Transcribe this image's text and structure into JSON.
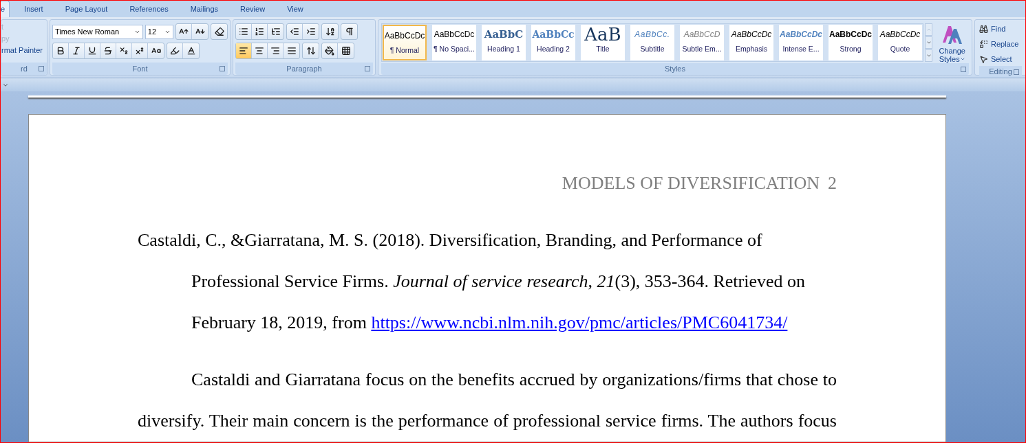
{
  "tabs": [
    {
      "label": "e",
      "selected": true
    },
    {
      "label": "Insert",
      "selected": false
    },
    {
      "label": "Page Layout",
      "selected": false
    },
    {
      "label": "References",
      "selected": false
    },
    {
      "label": "Mailings",
      "selected": false
    },
    {
      "label": "Review",
      "selected": false
    },
    {
      "label": "View",
      "selected": false
    }
  ],
  "clipboard": {
    "items": [
      {
        "label": "t",
        "disabled": true
      },
      {
        "label": "py",
        "disabled": true
      },
      {
        "label": "rmat Painter",
        "disabled": false
      }
    ],
    "group_label": "rd"
  },
  "font": {
    "name": "Times New Roman",
    "size": "12",
    "group_label": "Font"
  },
  "paragraph": {
    "group_label": "Paragraph",
    "alignments": [
      {
        "kind": "left",
        "selected": true
      },
      {
        "kind": "center",
        "selected": false
      },
      {
        "kind": "right",
        "selected": false
      },
      {
        "kind": "justify",
        "selected": false
      }
    ]
  },
  "styles": {
    "group_label": "Styles",
    "items": [
      {
        "kind": "normal",
        "sample": "AaBbCcDc",
        "label": "¶ Normal",
        "selected": true
      },
      {
        "kind": "normal",
        "sample": "AaBbCcDc",
        "label": "¶ No Spaci...",
        "selected": false
      },
      {
        "kind": "heading1",
        "sample": "AaBbC",
        "label": "Heading 1",
        "selected": false
      },
      {
        "kind": "heading2",
        "sample": "AaBbCc",
        "label": "Heading 2",
        "selected": false
      },
      {
        "kind": "title",
        "sample": "AaB",
        "label": "Title",
        "selected": false
      },
      {
        "kind": "subtitle",
        "sample": "AaBbCc.",
        "label": "Subtitle",
        "selected": false
      },
      {
        "kind": "subtle",
        "sample": "AaBbCcD",
        "label": "Subtle Em...",
        "selected": false
      },
      {
        "kind": "emphasis",
        "sample": "AaBbCcDc",
        "label": "Emphasis",
        "selected": false
      },
      {
        "kind": "intense",
        "sample": "AaBbCcDc",
        "label": "Intense E...",
        "selected": false
      },
      {
        "kind": "strong",
        "sample": "AaBbCcDc",
        "label": "Strong",
        "selected": false
      },
      {
        "kind": "emphasis",
        "sample": "AaBbCcDc",
        "label": "Quote",
        "selected": false
      }
    ],
    "change_styles": [
      "Change",
      "Styles"
    ]
  },
  "editing": {
    "group_label": "Editing",
    "items": [
      {
        "kind": "find",
        "label": "Find"
      },
      {
        "kind": "replace",
        "label": "Replace"
      },
      {
        "kind": "select",
        "label": "Select"
      }
    ]
  },
  "document": {
    "header_title": "MODELS OF DIVERSIFICATION",
    "page_number": "2",
    "reference_lines": [
      "Castaldi, C., &Giarratana, M. S. (2018). Diversification, Branding, and Performance of",
      "Professional Service Firms. *Journal of service research*, *21*(3), 353-364. Retrieved on",
      "February 18, 2019, from"
    ],
    "reference_link": "https://www.ncbi.nlm.nih.gov/pmc/articles/PMC6041734/",
    "body_lines": [
      "Castaldi and Giarratana focus on the benefits accrued by organizations/firms that chose to",
      "diversify. Their main concern is the performance of professional service firms. The authors focus"
    ]
  }
}
